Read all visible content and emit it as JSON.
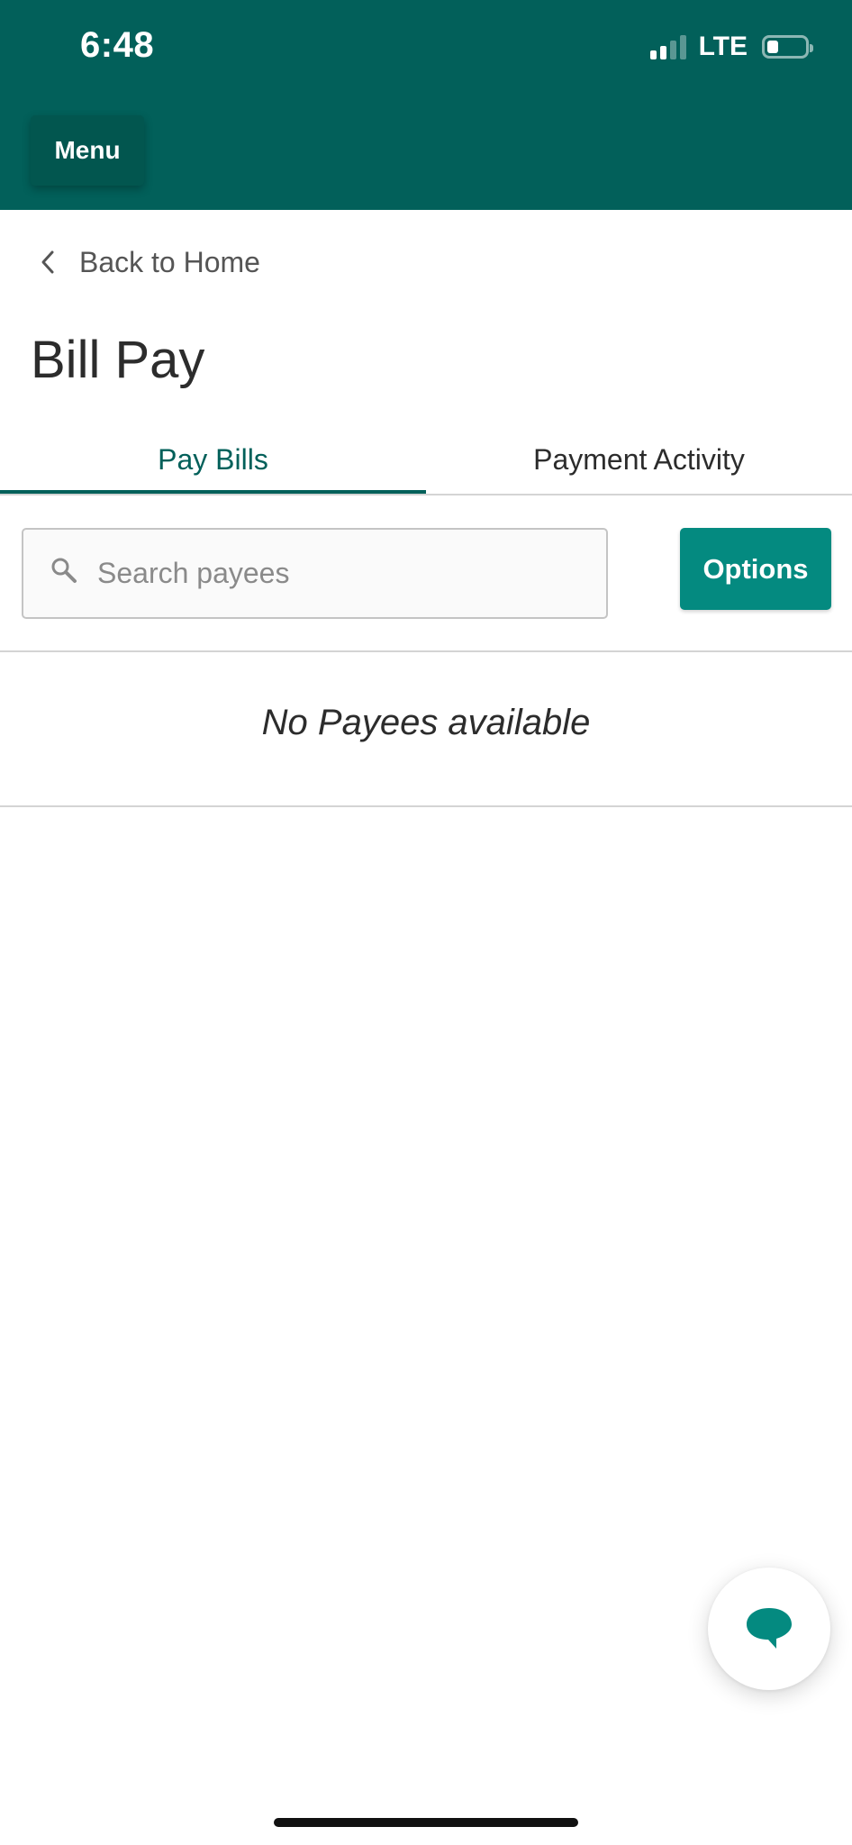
{
  "status_bar": {
    "time": "6:48",
    "network": "LTE",
    "signal_bars_active": 2,
    "signal_bars_total": 4
  },
  "header": {
    "menu_label": "Menu",
    "background_color": "#02605a"
  },
  "navigation": {
    "back_label": "Back to Home"
  },
  "page": {
    "title": "Bill Pay"
  },
  "tabs": [
    {
      "label": "Pay Bills",
      "active": true
    },
    {
      "label": "Payment Activity",
      "active": false
    }
  ],
  "search": {
    "placeholder": "Search payees",
    "value": ""
  },
  "options_label": "Options",
  "empty_state": {
    "message": "No Payees available"
  },
  "icons": {
    "back": "chevron-left-icon",
    "search": "search-icon",
    "chat": "chat-bubble-icon"
  },
  "colors": {
    "brand": "#02605a",
    "accent": "#048a80"
  }
}
